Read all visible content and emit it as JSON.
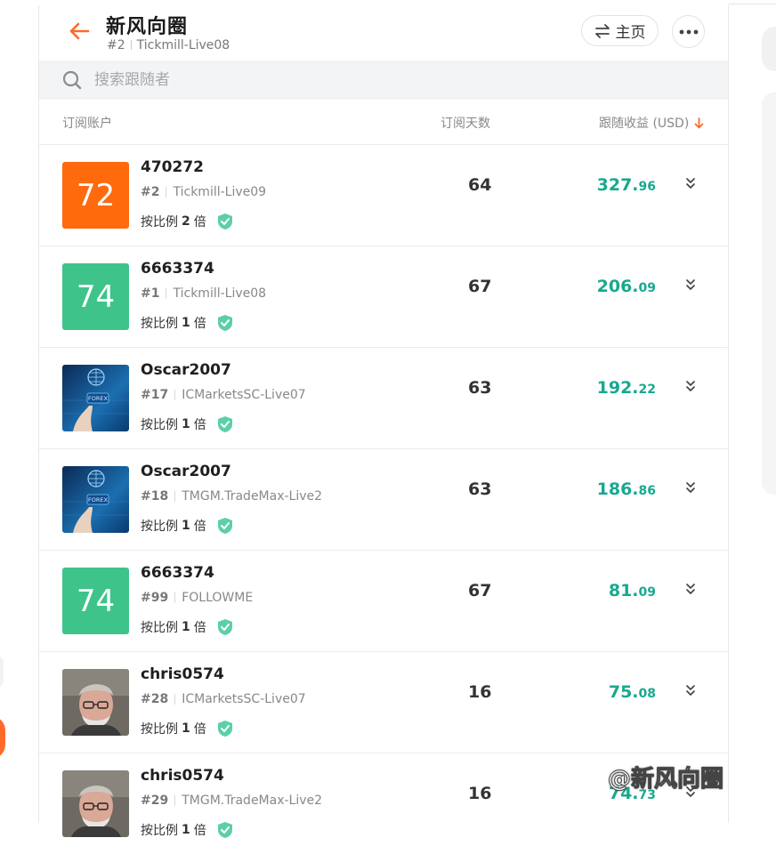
{
  "header": {
    "title": "新风向圈",
    "rank": "#2",
    "account": "Tickmill-Live08",
    "home_label": "主页"
  },
  "search": {
    "placeholder": "搜索跟随者"
  },
  "table": {
    "col_account": "订阅账户",
    "col_days": "订阅天数",
    "col_profit": "跟随收益 (USD)"
  },
  "rows": [
    {
      "avatar_type": "score",
      "score": "72",
      "score_color": "#ff6a0d",
      "name": "470272",
      "rank": "#2",
      "broker": "Tickmill-Live09",
      "ratio_prefix": "按比例",
      "ratio_mult": "2",
      "ratio_suffix": "倍",
      "days": "64",
      "profit_int": "327.",
      "profit_dec": "96"
    },
    {
      "avatar_type": "score",
      "score": "74",
      "score_color": "#3ec48a",
      "name": "6663374",
      "rank": "#1",
      "broker": "Tickmill-Live08",
      "ratio_prefix": "按比例",
      "ratio_mult": "1",
      "ratio_suffix": "倍",
      "days": "67",
      "profit_int": "206.",
      "profit_dec": "09"
    },
    {
      "avatar_type": "forex",
      "forex_text": "FOREX",
      "name": "Oscar2007",
      "rank": "#17",
      "broker": "ICMarketsSC-Live07",
      "ratio_prefix": "按比例",
      "ratio_mult": "1",
      "ratio_suffix": "倍",
      "days": "63",
      "profit_int": "192.",
      "profit_dec": "22"
    },
    {
      "avatar_type": "forex",
      "forex_text": "FOREX",
      "name": "Oscar2007",
      "rank": "#18",
      "broker": "TMGM.TradeMax-Live2",
      "ratio_prefix": "按比例",
      "ratio_mult": "1",
      "ratio_suffix": "倍",
      "days": "63",
      "profit_int": "186.",
      "profit_dec": "86"
    },
    {
      "avatar_type": "score",
      "score": "74",
      "score_color": "#3ec48a",
      "name": "6663374",
      "rank": "#99",
      "broker": "FOLLOWME",
      "ratio_prefix": "按比例",
      "ratio_mult": "1",
      "ratio_suffix": "倍",
      "days": "67",
      "profit_int": "81.",
      "profit_dec": "09"
    },
    {
      "avatar_type": "photo",
      "name": "chris0574",
      "rank": "#28",
      "broker": "ICMarketsSC-Live07",
      "ratio_prefix": "按比例",
      "ratio_mult": "1",
      "ratio_suffix": "倍",
      "days": "16",
      "profit_int": "75.",
      "profit_dec": "08"
    },
    {
      "avatar_type": "photo",
      "name": "chris0574",
      "rank": "#29",
      "broker": "TMGM.TradeMax-Live2",
      "ratio_prefix": "按比例",
      "ratio_mult": "1",
      "ratio_suffix": "倍",
      "days": "16",
      "profit_int": "74.",
      "profit_dec": "73"
    }
  ],
  "colors": {
    "accent": "#ff6a2b",
    "profit": "#17a98e",
    "verified": "#5ccfa9"
  },
  "icons": {
    "back": "arrow-left-icon",
    "home": "swap-icon",
    "more": "more-dots-icon",
    "search": "search-icon",
    "sort": "arrow-down-icon",
    "verified": "shield-check-icon",
    "expand": "chevron-double-down-icon"
  },
  "watermark": "@新风向圈"
}
